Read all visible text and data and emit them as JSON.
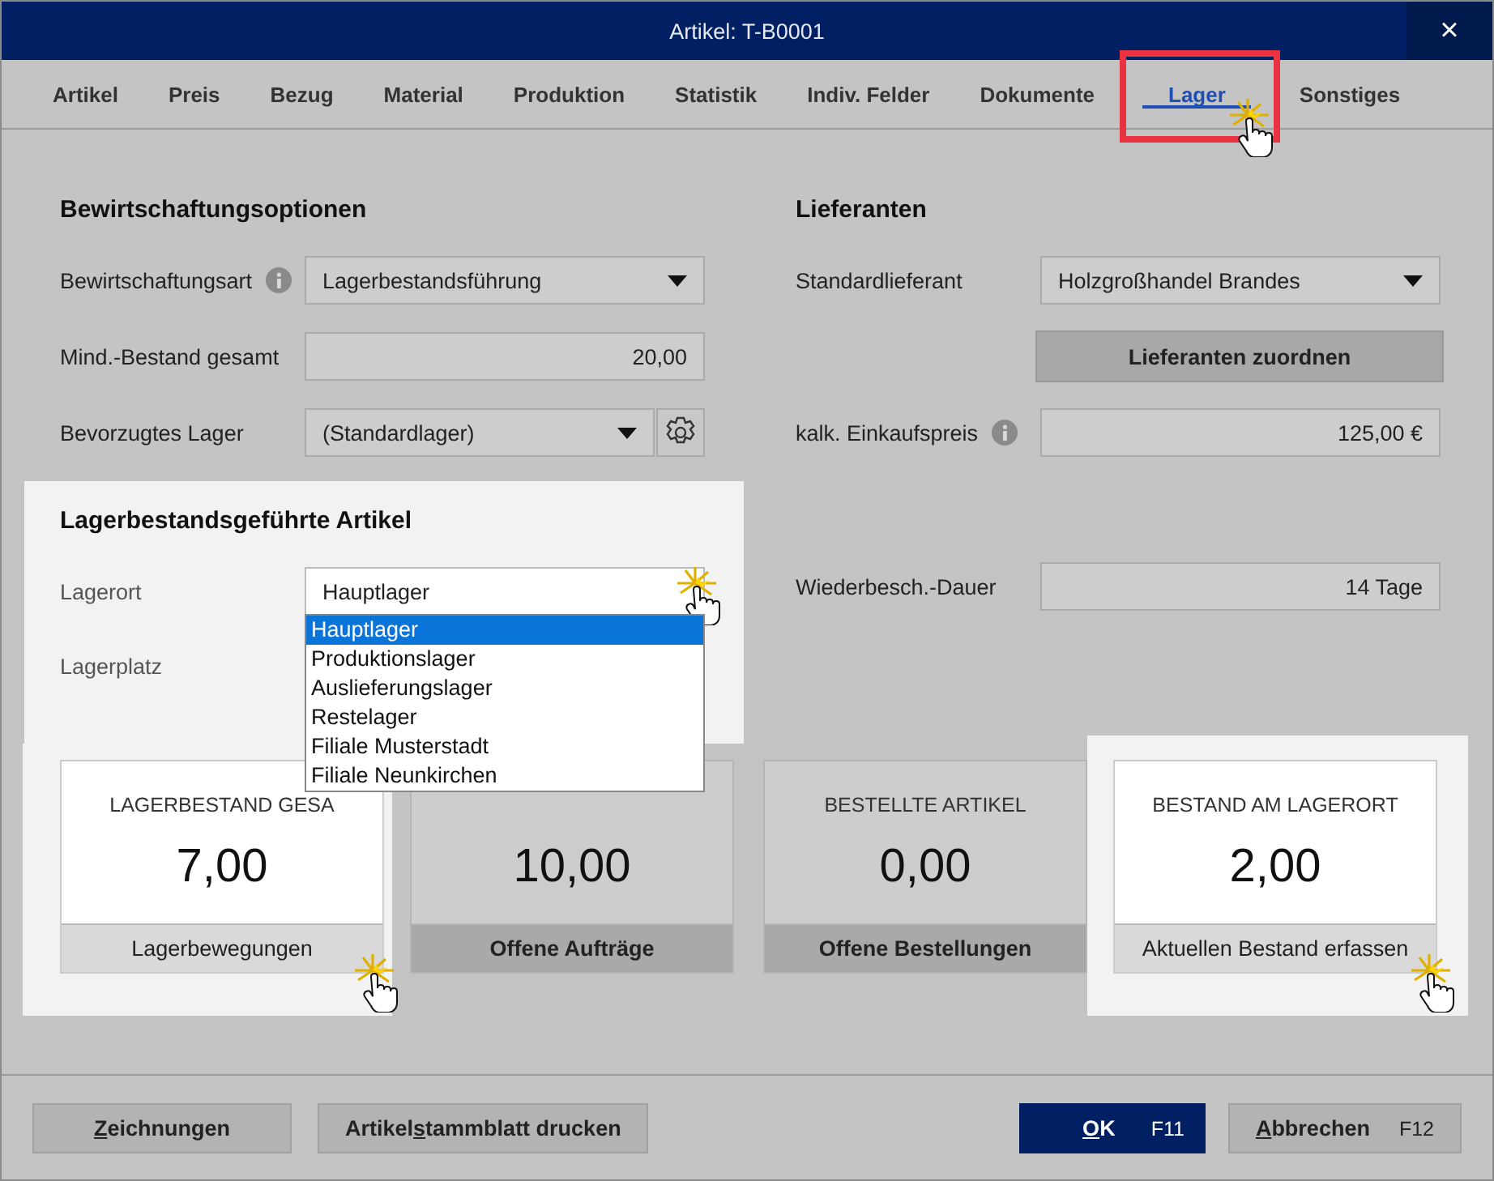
{
  "window": {
    "title": "Artikel: T-B0001",
    "close": "×"
  },
  "tabs": [
    {
      "label": "Artikel",
      "selected": false
    },
    {
      "label": "Preis",
      "selected": false
    },
    {
      "label": "Bezug",
      "selected": false
    },
    {
      "label": "Material",
      "selected": false
    },
    {
      "label": "Produktion",
      "selected": false
    },
    {
      "label": "Statistik",
      "selected": false
    },
    {
      "label": "Indiv. Felder",
      "selected": false
    },
    {
      "label": "Dokumente",
      "selected": false
    },
    {
      "label": "Lager",
      "selected": true,
      "marked": true,
      "pointer": true
    },
    {
      "label": "Sonstiges",
      "selected": false
    }
  ],
  "bewirtschaftung": {
    "heading": "Bewirtschaftungsoptionen",
    "rows": [
      {
        "kind": "select",
        "label": "Bewirtschaftungsart",
        "info": true,
        "value": "Lagerbestandsführung"
      },
      {
        "kind": "number",
        "label": "Mind.-Bestand gesamt",
        "value": "20,00"
      },
      {
        "kind": "select",
        "label": "Bevorzugtes Lager",
        "value": "(Standardlager)",
        "settings": true
      }
    ]
  },
  "lieferanten": {
    "heading": "Lieferanten",
    "rows": [
      {
        "kind": "select",
        "label": "Standardlieferant",
        "value": "Holzgroßhandel Brandes"
      },
      {
        "kind": "button",
        "label": "Lieferanten zuordnen"
      },
      {
        "kind": "number",
        "label": "kalk. Einkaufspreis",
        "info": true,
        "value": "125,00 €"
      },
      {
        "kind": "spacer"
      },
      {
        "kind": "number",
        "label": "Wiederbesch.-Dauer",
        "value": "14 Tage"
      }
    ]
  },
  "lagerbestand_panel": {
    "heading": "Lagerbestandsgeführte Artikel",
    "lagerort": {
      "label": "Lagerort",
      "value": "Hauptlager",
      "pointer": true,
      "options": [
        {
          "label": "Hauptlager",
          "selected": true
        },
        {
          "label": "Produktionslager",
          "selected": false
        },
        {
          "label": "Auslieferungslager",
          "selected": false
        },
        {
          "label": "Restelager",
          "selected": false
        },
        {
          "label": "Filiale Musterstadt",
          "selected": false
        },
        {
          "label": "Filiale Neunkirchen",
          "selected": false
        }
      ]
    },
    "lagerplatz": {
      "label": "Lagerplatz"
    }
  },
  "tiles": [
    {
      "title": "LAGERBESTAND GESA",
      "value": "7,00",
      "action": "Lagerbewegungen",
      "highlighted": true,
      "pointer": true
    },
    {
      "value": "10,00",
      "action": "Offene Aufträge",
      "highlighted": false
    },
    {
      "title": "BESTELLTE ARTIKEL",
      "value": "0,00",
      "action": "Offene Bestellungen",
      "highlighted": false
    },
    {
      "title": "BESTAND AM LAGERORT",
      "value": "2,00",
      "action": "Aktuellen Bestand erfassen",
      "highlighted": true,
      "pointer": true
    }
  ],
  "footer_buttons": [
    {
      "kind": "normal",
      "key": "Z",
      "post": "eichnungen"
    },
    {
      "kind": "normal",
      "pre": "Artikel",
      "key": "s",
      "post": "tammblatt drucken"
    },
    {
      "kind": "spacer"
    },
    {
      "kind": "primary",
      "key": "O",
      "post": "K",
      "shortcut": "F11"
    },
    {
      "kind": "normal",
      "key": "A",
      "post": "bbrechen",
      "shortcut": "F12"
    }
  ]
}
